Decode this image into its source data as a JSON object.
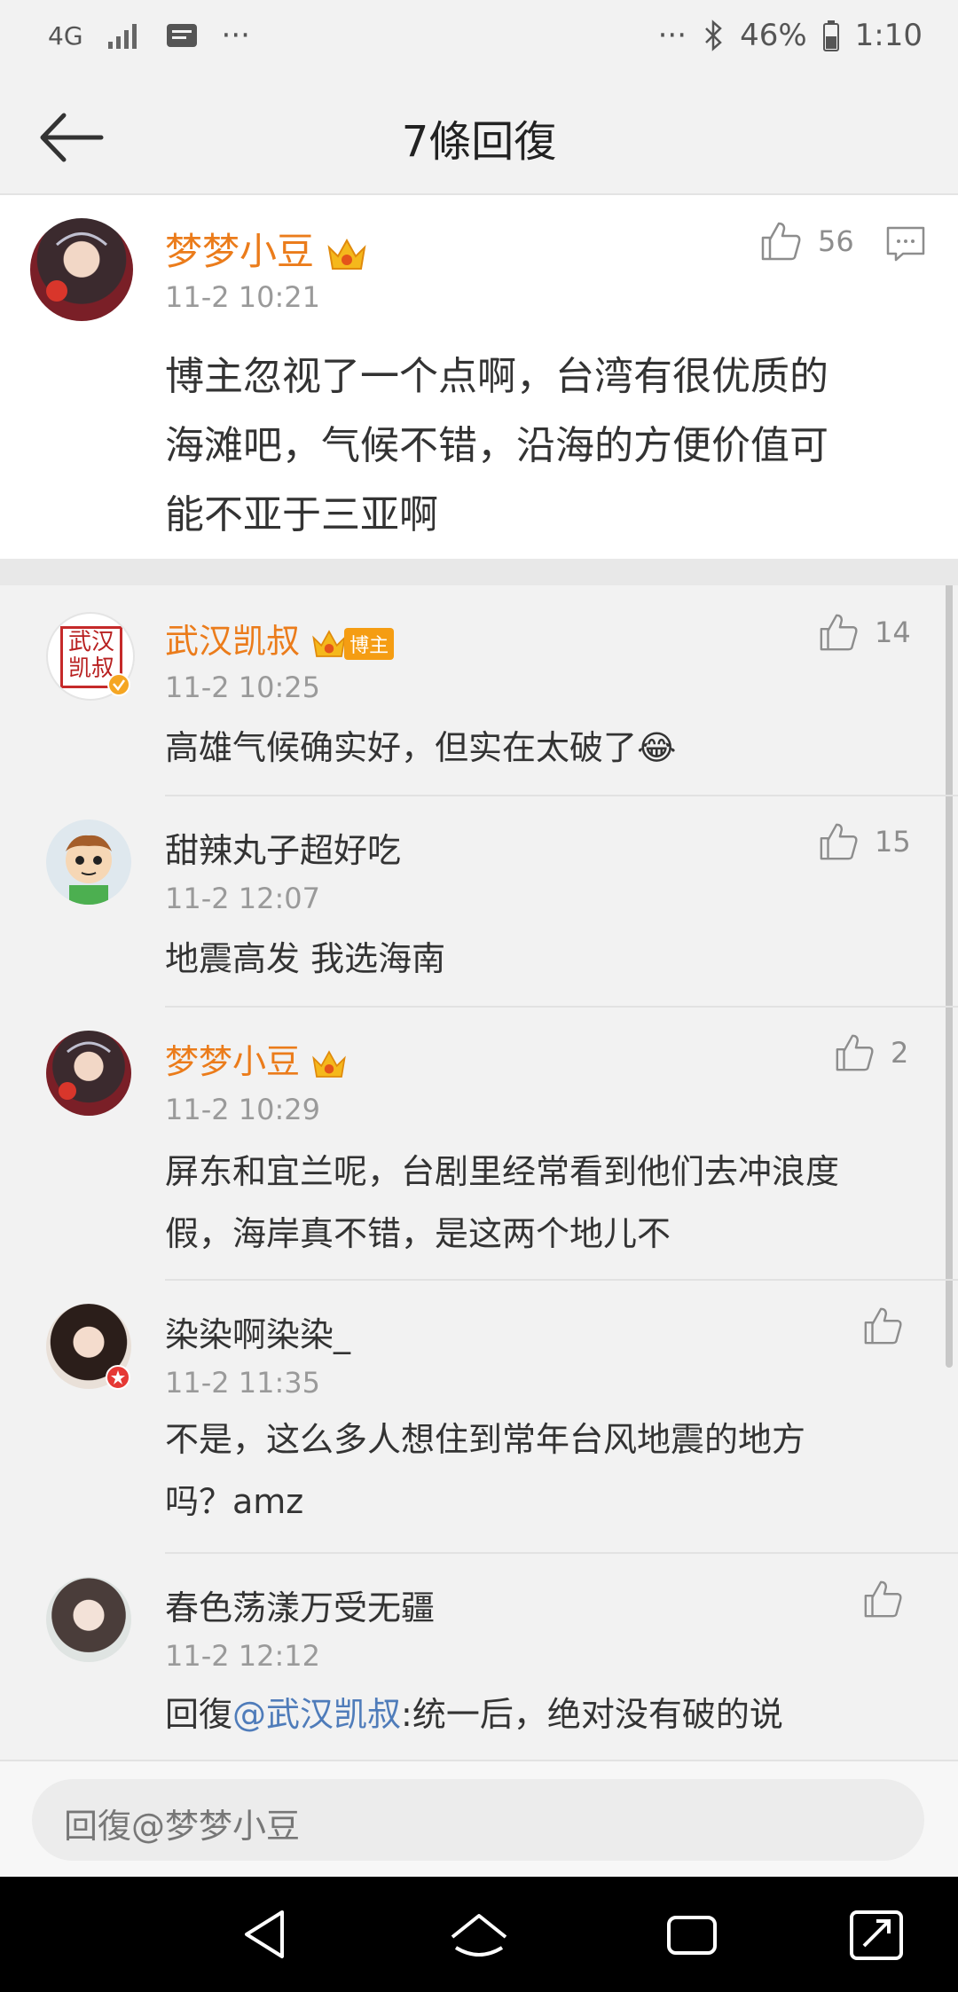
{
  "status": {
    "network": "4G",
    "dots_left": "···",
    "dots_right": "···",
    "battery": "46%",
    "time": "1:10"
  },
  "header": {
    "title": "7條回復"
  },
  "top_comment": {
    "name": "梦梦小豆",
    "time": "11-2 10:21",
    "likes": "56",
    "text_line1": "博主忽视了一个点啊，台湾有很优质的",
    "text_line2": "海滩吧，气候不错，沿海的方便价值可",
    "text_line3": "能不亚于三亚啊"
  },
  "replies": [
    {
      "name": "武汉凯叔",
      "badge": "博主",
      "time": "11-2 10:25",
      "likes": "14",
      "text": "高雄气候确实好，但实在太破了😂"
    },
    {
      "name": "甜辣丸子超好吃",
      "time": "11-2 12:07",
      "likes": "15",
      "text": "地震高发 我选海南"
    },
    {
      "name": "梦梦小豆",
      "time": "11-2 10:29",
      "likes": "2",
      "text_line1": "屏东和宜兰呢，台剧里经常看到他们去冲浪度",
      "text_line2": "假，海岸真不错，是这两个地儿不"
    },
    {
      "name": "染染啊染染_",
      "time": "11-2 11:35",
      "likes": "",
      "text_line1": "不是，这么多人想住到常年台风地震的地方",
      "text_line2": "吗？amz"
    },
    {
      "name": "春色荡漾万受无疆",
      "time": "11-2 12:12",
      "likes": "",
      "reply_prefix": "回復",
      "mention": "@武汉凯叔",
      "text_rest": ":统一后，绝对没有破的说"
    }
  ],
  "input": {
    "placeholder": "回復@梦梦小豆"
  },
  "avatar_seal": {
    "line1": "武汉",
    "line2": "凯叔"
  },
  "colors": {
    "vip_name": "#eb7c1b",
    "mention": "#4f7cba",
    "badge": "#f59d13"
  }
}
